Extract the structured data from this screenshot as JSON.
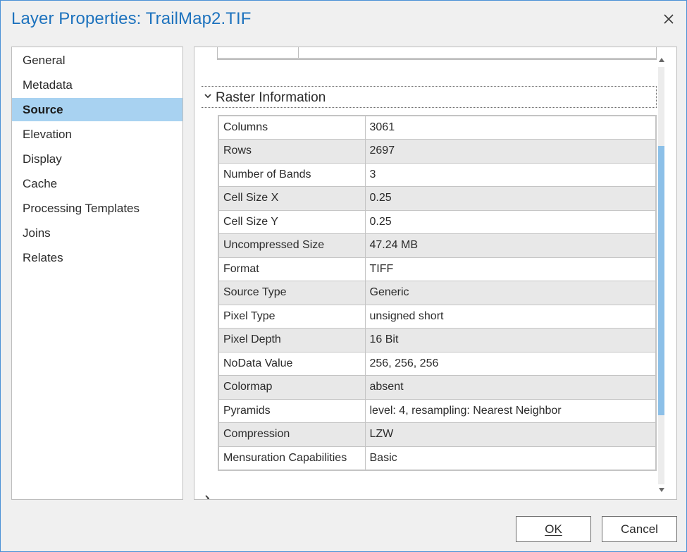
{
  "window": {
    "title": "Layer Properties: TrailMap2.TIF",
    "accent_color": "#1e73be",
    "close_icon": "close-icon"
  },
  "sidebar": {
    "selected_color": "#a8d2f1",
    "items": [
      {
        "label": "General"
      },
      {
        "label": "Metadata"
      },
      {
        "label": "Source",
        "selected": true
      },
      {
        "label": "Elevation"
      },
      {
        "label": "Display"
      },
      {
        "label": "Cache"
      },
      {
        "label": "Processing Templates"
      },
      {
        "label": "Joins"
      },
      {
        "label": "Relates"
      }
    ]
  },
  "section": {
    "title": "Raster Information",
    "expand_icon": "chevron-down-icon",
    "rows": [
      {
        "key": "Columns",
        "value": "3061"
      },
      {
        "key": "Rows",
        "value": "2697"
      },
      {
        "key": "Number of Bands",
        "value": "3"
      },
      {
        "key": "Cell Size X",
        "value": "0.25"
      },
      {
        "key": "Cell Size Y",
        "value": "0.25"
      },
      {
        "key": "Uncompressed Size",
        "value": "47.24 MB"
      },
      {
        "key": "Format",
        "value": "TIFF"
      },
      {
        "key": "Source Type",
        "value": "Generic"
      },
      {
        "key": "Pixel Type",
        "value": "unsigned short"
      },
      {
        "key": "Pixel Depth",
        "value": "16 Bit"
      },
      {
        "key": "NoData Value",
        "value": "256, 256, 256"
      },
      {
        "key": "Colormap",
        "value": "absent"
      },
      {
        "key": "Pyramids",
        "value": "level: 4, resampling: Nearest Neighbor"
      },
      {
        "key": "Compression",
        "value": "LZW"
      },
      {
        "key": "Mensuration Capabilities",
        "value": "Basic"
      }
    ]
  },
  "footer": {
    "ok_label": "OK",
    "cancel_label": "Cancel"
  }
}
